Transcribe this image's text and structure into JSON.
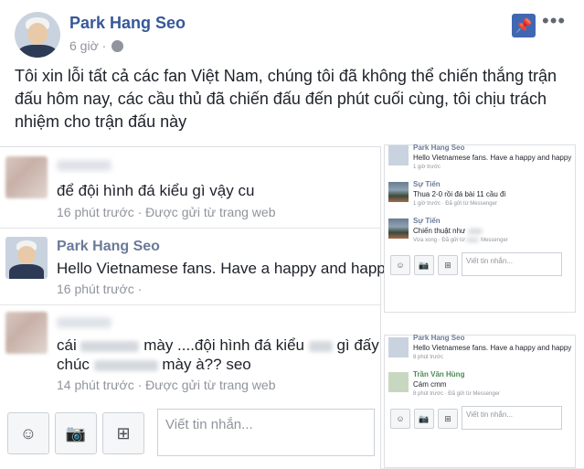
{
  "post": {
    "author": "Park Hang Seo",
    "time": "6 giờ ·",
    "text": "Tôi xin lỗi tất cả các fan Việt Nam, chúng tôi đã không thể chiến thắng trận đấu hôm nay, các cầu thủ đã chiến đấu đến phút cuối cùng, tôi chịu trách nhiệm cho trận đấu này",
    "more_icon": "•••",
    "pin_icon": "📌"
  },
  "chat_left": {
    "messages": [
      {
        "text": "để đội hình đá kiểu gì vậy cu",
        "time": "16 phút trước · Được gửi từ trang web"
      },
      {
        "name": "Park Hang Seo",
        "text": "Hello Vietnamese fans. Have a happy and happ",
        "time": "16 phút trước ·"
      },
      {
        "text_a": "cái",
        "text_b": "mày ....đội hình đá kiểu",
        "text_c": "gì đấy",
        "text_d": "chúc",
        "text_e": "mày à?? seo",
        "time": "14 phút trước · Được gửi từ trang web"
      }
    ],
    "buttons": {
      "emoji": "☺",
      "camera": "📷",
      "sticker": "⊞"
    },
    "composer_placeholder": "Viết tin nhắn..."
  },
  "chat_right_top": {
    "messages": [
      {
        "name": "Park Hang Seo",
        "text": "Hello Vietnamese fans. Have a happy and happy",
        "time": "1 giờ trước"
      },
      {
        "name": "Sự Tiến",
        "text": "Thua 2-0 rồi đá bài 11 cầu đi",
        "time": "1 giờ trước · Đã gửi từ Messenger"
      },
      {
        "name": "Sự Tiến",
        "text": "Chiến thuật như",
        "time": "Vừa xong · Đã gửi từ",
        "time_b": "Messenger"
      }
    ],
    "composer_placeholder": "Viết tin nhắn..."
  },
  "chat_right_bottom": {
    "messages": [
      {
        "name": "Park Hang Seo",
        "text": "Hello Vietnamese fans. Have a happy and happy",
        "time": "8 phút trước"
      },
      {
        "name": "Trần Văn Hùng",
        "text": "Cám cmm",
        "time": "8 phút trước · Đã gửi từ Messenger"
      }
    ],
    "composer_placeholder": "Viết tin nhắn..."
  }
}
